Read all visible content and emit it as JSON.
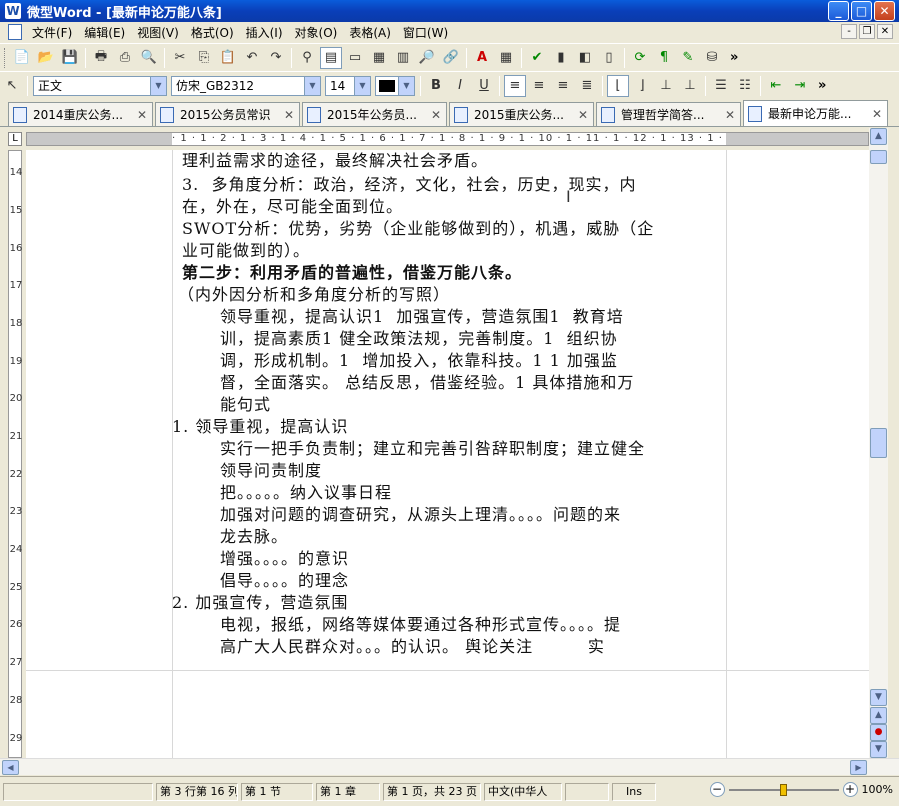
{
  "window": {
    "app_glyph": "W",
    "title": "微型Word - [最新申论万能八条]",
    "min_label": "_",
    "max_label": "□",
    "close_label": "✕"
  },
  "menubar": {
    "items": [
      "文件(F)",
      "编辑(E)",
      "视图(V)",
      "格式(O)",
      "插入(I)",
      "对象(O)",
      "表格(A)",
      "窗口(W)"
    ],
    "mdi_min": "-",
    "mdi_restore": "❐",
    "mdi_close": "✕"
  },
  "toolbar": {
    "style_value": "正文",
    "font_value": "仿宋_GB2312",
    "size_value": "14",
    "bold_label": "B",
    "italic_label": "I",
    "underline_label": "U",
    "more_label": "»"
  },
  "tabs": [
    {
      "label": "2014重庆公务..."
    },
    {
      "label": "2015公务员常识"
    },
    {
      "label": "2015年公务员..."
    },
    {
      "label": "2015重庆公务..."
    },
    {
      "label": "管理哲学简答..."
    },
    {
      "label": "最新申论万能..."
    }
  ],
  "ruler": {
    "corner_label": "L",
    "scale": "· 1 · 1 · 2 · 1 · 3 · 1 · 4 · 1 · 5 · 1 · 6 · 1 · 7 · 1 · 8 · 1 · 9 · 1 · 10 · 1 · 11 · 1 · 12 · 1 · 13 · 1 · 14 · "
  },
  "vruler_numbers": [
    "14",
    "15",
    "16",
    "17",
    "18",
    "19",
    "20",
    "21",
    "22",
    "23",
    "24",
    "25",
    "26",
    "27",
    "28",
    "29"
  ],
  "document": {
    "lines": [
      "理利益需求的途径，最终解决社会矛盾。",
      "3.  多角度分析：政治，经济，文化，社会，历史，现实，内",
      "在，外在，尽可能全面到位。",
      "SWOT分析：优势，劣势（企业能够做到的），机遇，威胁（企",
      "业可能做到的）。",
      "第二步：利用矛盾的普遍性，借鉴万能八条。",
      "（内外因分析和多角度分析的写照）",
      "领导重视，提高认识1  加强宣传，营造氛围1  教育培",
      "训，提高素质1 健全政策法规，完善制度。1  组织协",
      "调，形成机制。1  增加投入，依靠科技。1 1 加强监",
      "督，全面落实。 总结反思，借鉴经验。1 具体措施和万",
      "能句式",
      "1. 领导重视，提高认识",
      "实行一把手负责制；建立和完善引咎辞职制度；建立健全",
      "领导问责制度",
      "把。。。。。纳入议事日程",
      "加强对问题的调查研究，从源头上理清。。。。问题的来",
      "龙去脉。",
      "增强。。。。的意识",
      "倡导。。。。的理念",
      "2. 加强宣传，营造氛围",
      "电视，报纸，网络等媒体要通过各种形式宣传。。。。提",
      "高广大人民群众对。。。的认识。 舆论关注         实"
    ],
    "cursor_glyph": "I"
  },
  "scroll": {
    "up": "▲",
    "down": "▼",
    "prev_page": "▲",
    "select_browse": "●",
    "next_page": "▼",
    "left": "◀",
    "right": "▶"
  },
  "statusbar": {
    "position": "第 3 行第 16 列",
    "section": "第 1 节",
    "chapter": "第 1 章",
    "page": "第 1 页，共 23 页",
    "language": "中文(中华人",
    "mode": "Ins",
    "zoom_minus": "−",
    "zoom_plus": "+",
    "zoom": "100%",
    "zoom_level_fraction": 0.5
  }
}
